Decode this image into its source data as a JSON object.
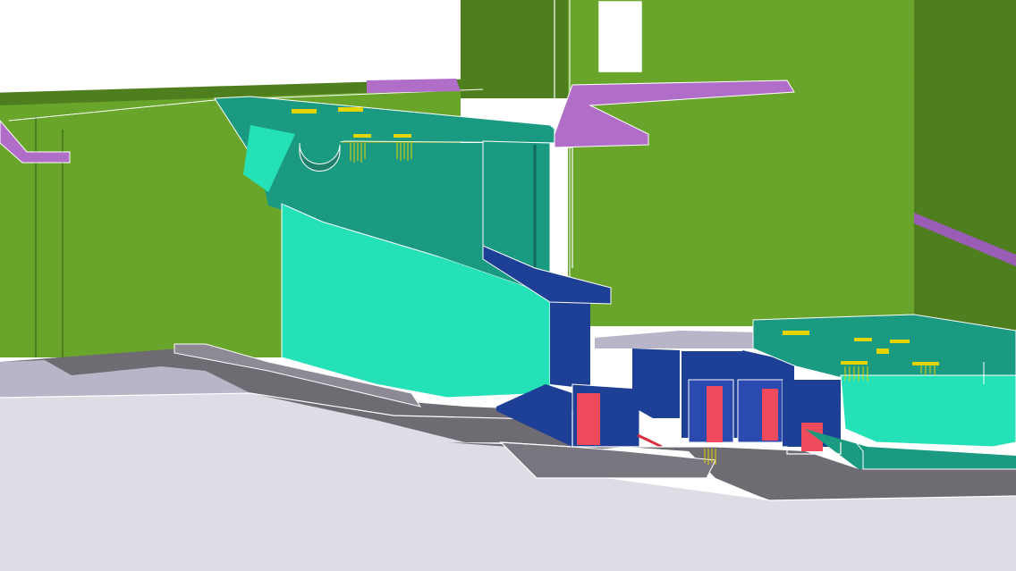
{
  "scene": {
    "view": "3d-model-section-viewport",
    "colors": {
      "background": "#ffffff",
      "floor": "#dcdde5",
      "green_wall": "#69a42a",
      "green_dark": "#4e7d1f",
      "teal": "#1a9a80",
      "teal_light": "#24e0b6",
      "purple": "#b06ec8",
      "gray_slab": "#6e6b73",
      "blue": "#1e3f96",
      "red": "#f04b5c",
      "yellow": "#e4d400",
      "edge": "#ffffff"
    }
  }
}
